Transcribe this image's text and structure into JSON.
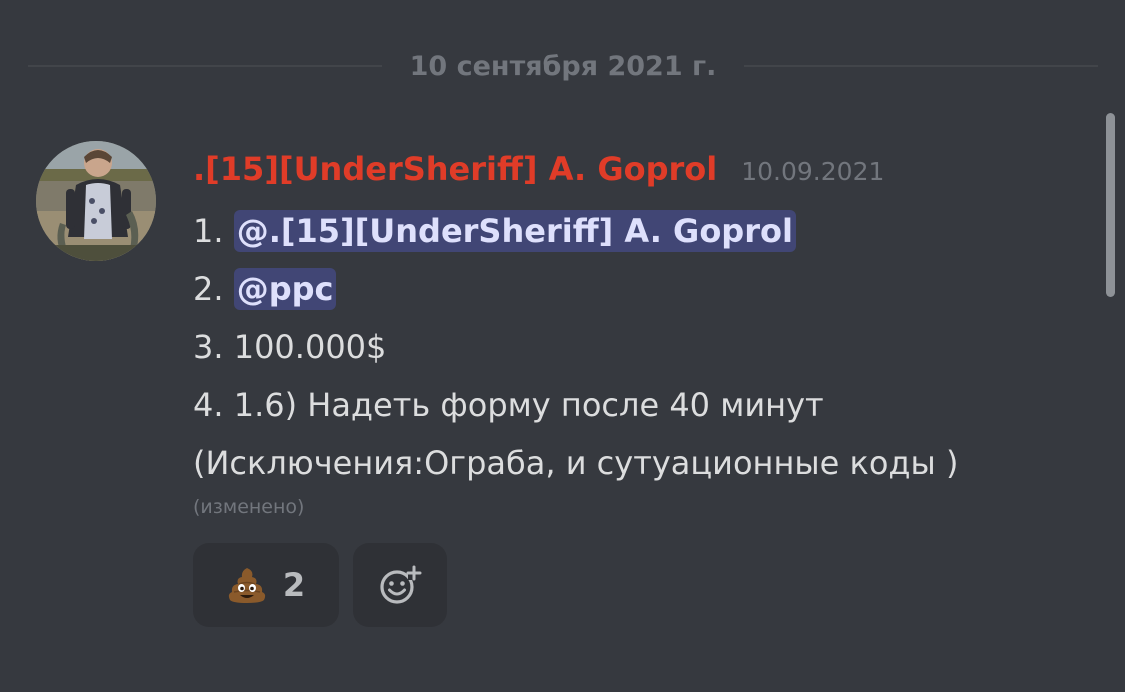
{
  "date_divider": "10 сентября 2021 г.",
  "message": {
    "author": ".[15][UnderSheriff] A. Goprol",
    "timestamp": "10.09.2021",
    "lines": [
      {
        "prefix": "1. ",
        "mention": "@.[15][UnderSheriff] A. Goprol"
      },
      {
        "prefix": "2. ",
        "mention": "@ppc"
      },
      {
        "text": "3. 100.000$"
      },
      {
        "text": "4. 1.6) Надеть форму после 40 минут"
      },
      {
        "text": "(Исключения:Ограба, и сутуационные коды )"
      }
    ],
    "edited": "(изменено)"
  },
  "reactions": [
    {
      "emoji": "poop-emoji",
      "count": "2"
    },
    {
      "emoji": "add-reaction-icon"
    }
  ],
  "colors": {
    "background": "#36393f",
    "author": "#e03c28",
    "mention_bg": "#414675",
    "mention_text": "#dee0fc",
    "muted": "#72767d",
    "reaction_bg": "#2f3136"
  }
}
